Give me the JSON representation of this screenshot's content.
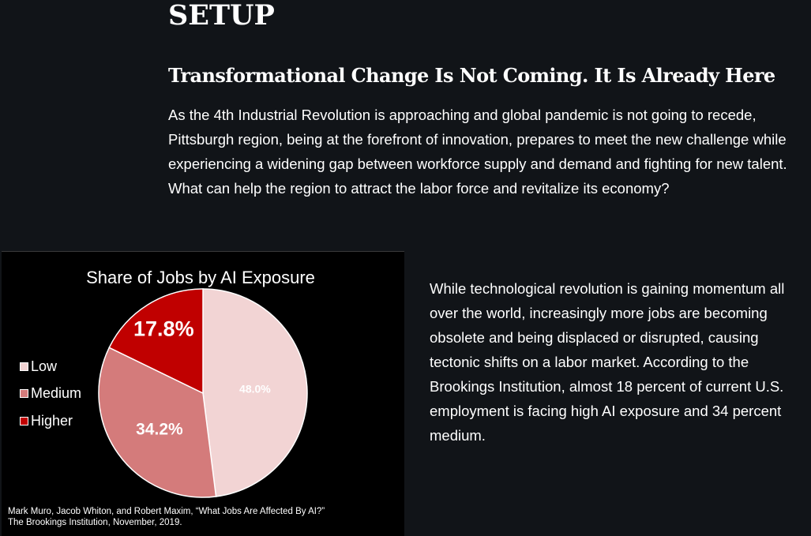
{
  "page": {
    "heading": "SETUP",
    "subheading": "Transformational Change Is Not Coming. It Is Already Here",
    "intro": "As the 4th Industrial Revolution is approaching and global pandemic is not going to recede, Pittsburgh region, being at the forefront of innovation, prepares to meet the new challenge while experiencing a widening gap between workforce supply and demand and fighting for new talent. What can help the region to attract the labor force and revitalize its economy?",
    "body": "While technological revolution is gaining momentum all over the world, increasingly more jobs are becoming obsolete and being displaced or disrupted, causing tectonic shifts on a labor market. According to the Brookings Institution, almost 18 percent of current U.S. employment is facing high AI exposure and 34 percent medium."
  },
  "chart_data": {
    "type": "pie",
    "title": "Share of Jobs by AI Exposure",
    "categories": [
      "Low",
      "Medium",
      "Higher"
    ],
    "values": [
      48.0,
      34.2,
      17.8
    ],
    "labels": [
      "48.0%",
      "34.2%",
      "17.8%"
    ],
    "colors": [
      "#f2d4d4",
      "#d47b7b",
      "#c00000"
    ],
    "start_angle_deg": 0,
    "direction": "clockwise",
    "legend_position": "left",
    "citation": "Mark Muro, Jacob Whiton, and Robert Maxim, “What Jobs Are Affected By AI?” The Brookings Institution, November, 2019."
  }
}
